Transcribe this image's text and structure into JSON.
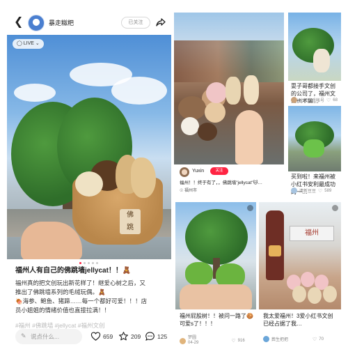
{
  "post": {
    "author": "暴走糍粑",
    "follow_label": "已关注",
    "live_label": "LIVE",
    "title": "福州人有自己的佛跳墙jellycat！！🧸",
    "body": [
      "福州真的把文创玩出新花样了！继爱心树之后，又",
      "推出了佛跳墙系列的毛绒玩偶。🧸",
      "🍖海参、鲍鱼、猪蹄……每一个都好可爱！！！店",
      "员小姐姐的情绪价值也直接拉满！！"
    ],
    "faded_line": "#福州 #佛跳墙 #jellycat #福州文创",
    "image_counter": {
      "current": 1,
      "total": 5
    },
    "comment_placeholder": "说点什么...",
    "likes": "659",
    "stars": "209",
    "comments": "125"
  },
  "feed": {
    "yuxin": {
      "name": "Yuxin",
      "follow_label": "关注",
      "text": "福州！！终于有了，，佛跳墙\"jellycat\"🐱…",
      "location": "福州市"
    },
    "cards": [
      {
        "title": "耍子哥都接手文创的公司了，福州文创也不输…",
        "author": "小仔游戏帐号",
        "likes": "68"
      },
      {
        "title": "买到啦！来福州被小红书安利最成功的一…",
        "author": "清新豆豆",
        "likes": "589"
      },
      {
        "title": "福州屁股树！！被问一路了🍪可爱s了！！！",
        "author": "梦圆",
        "date": "04-29",
        "likes": "916"
      },
      {
        "title": "我太爱福州！3爱小红书文创已经占据了我…",
        "author": "葬生把把",
        "likes": "70"
      }
    ],
    "sign_texts": {
      "fuzhou": "福州"
    }
  },
  "colors": {
    "accent": "#ff2442",
    "sky": "#87b9e7",
    "tree": "#3d7f32",
    "basket": "#c8955a"
  }
}
